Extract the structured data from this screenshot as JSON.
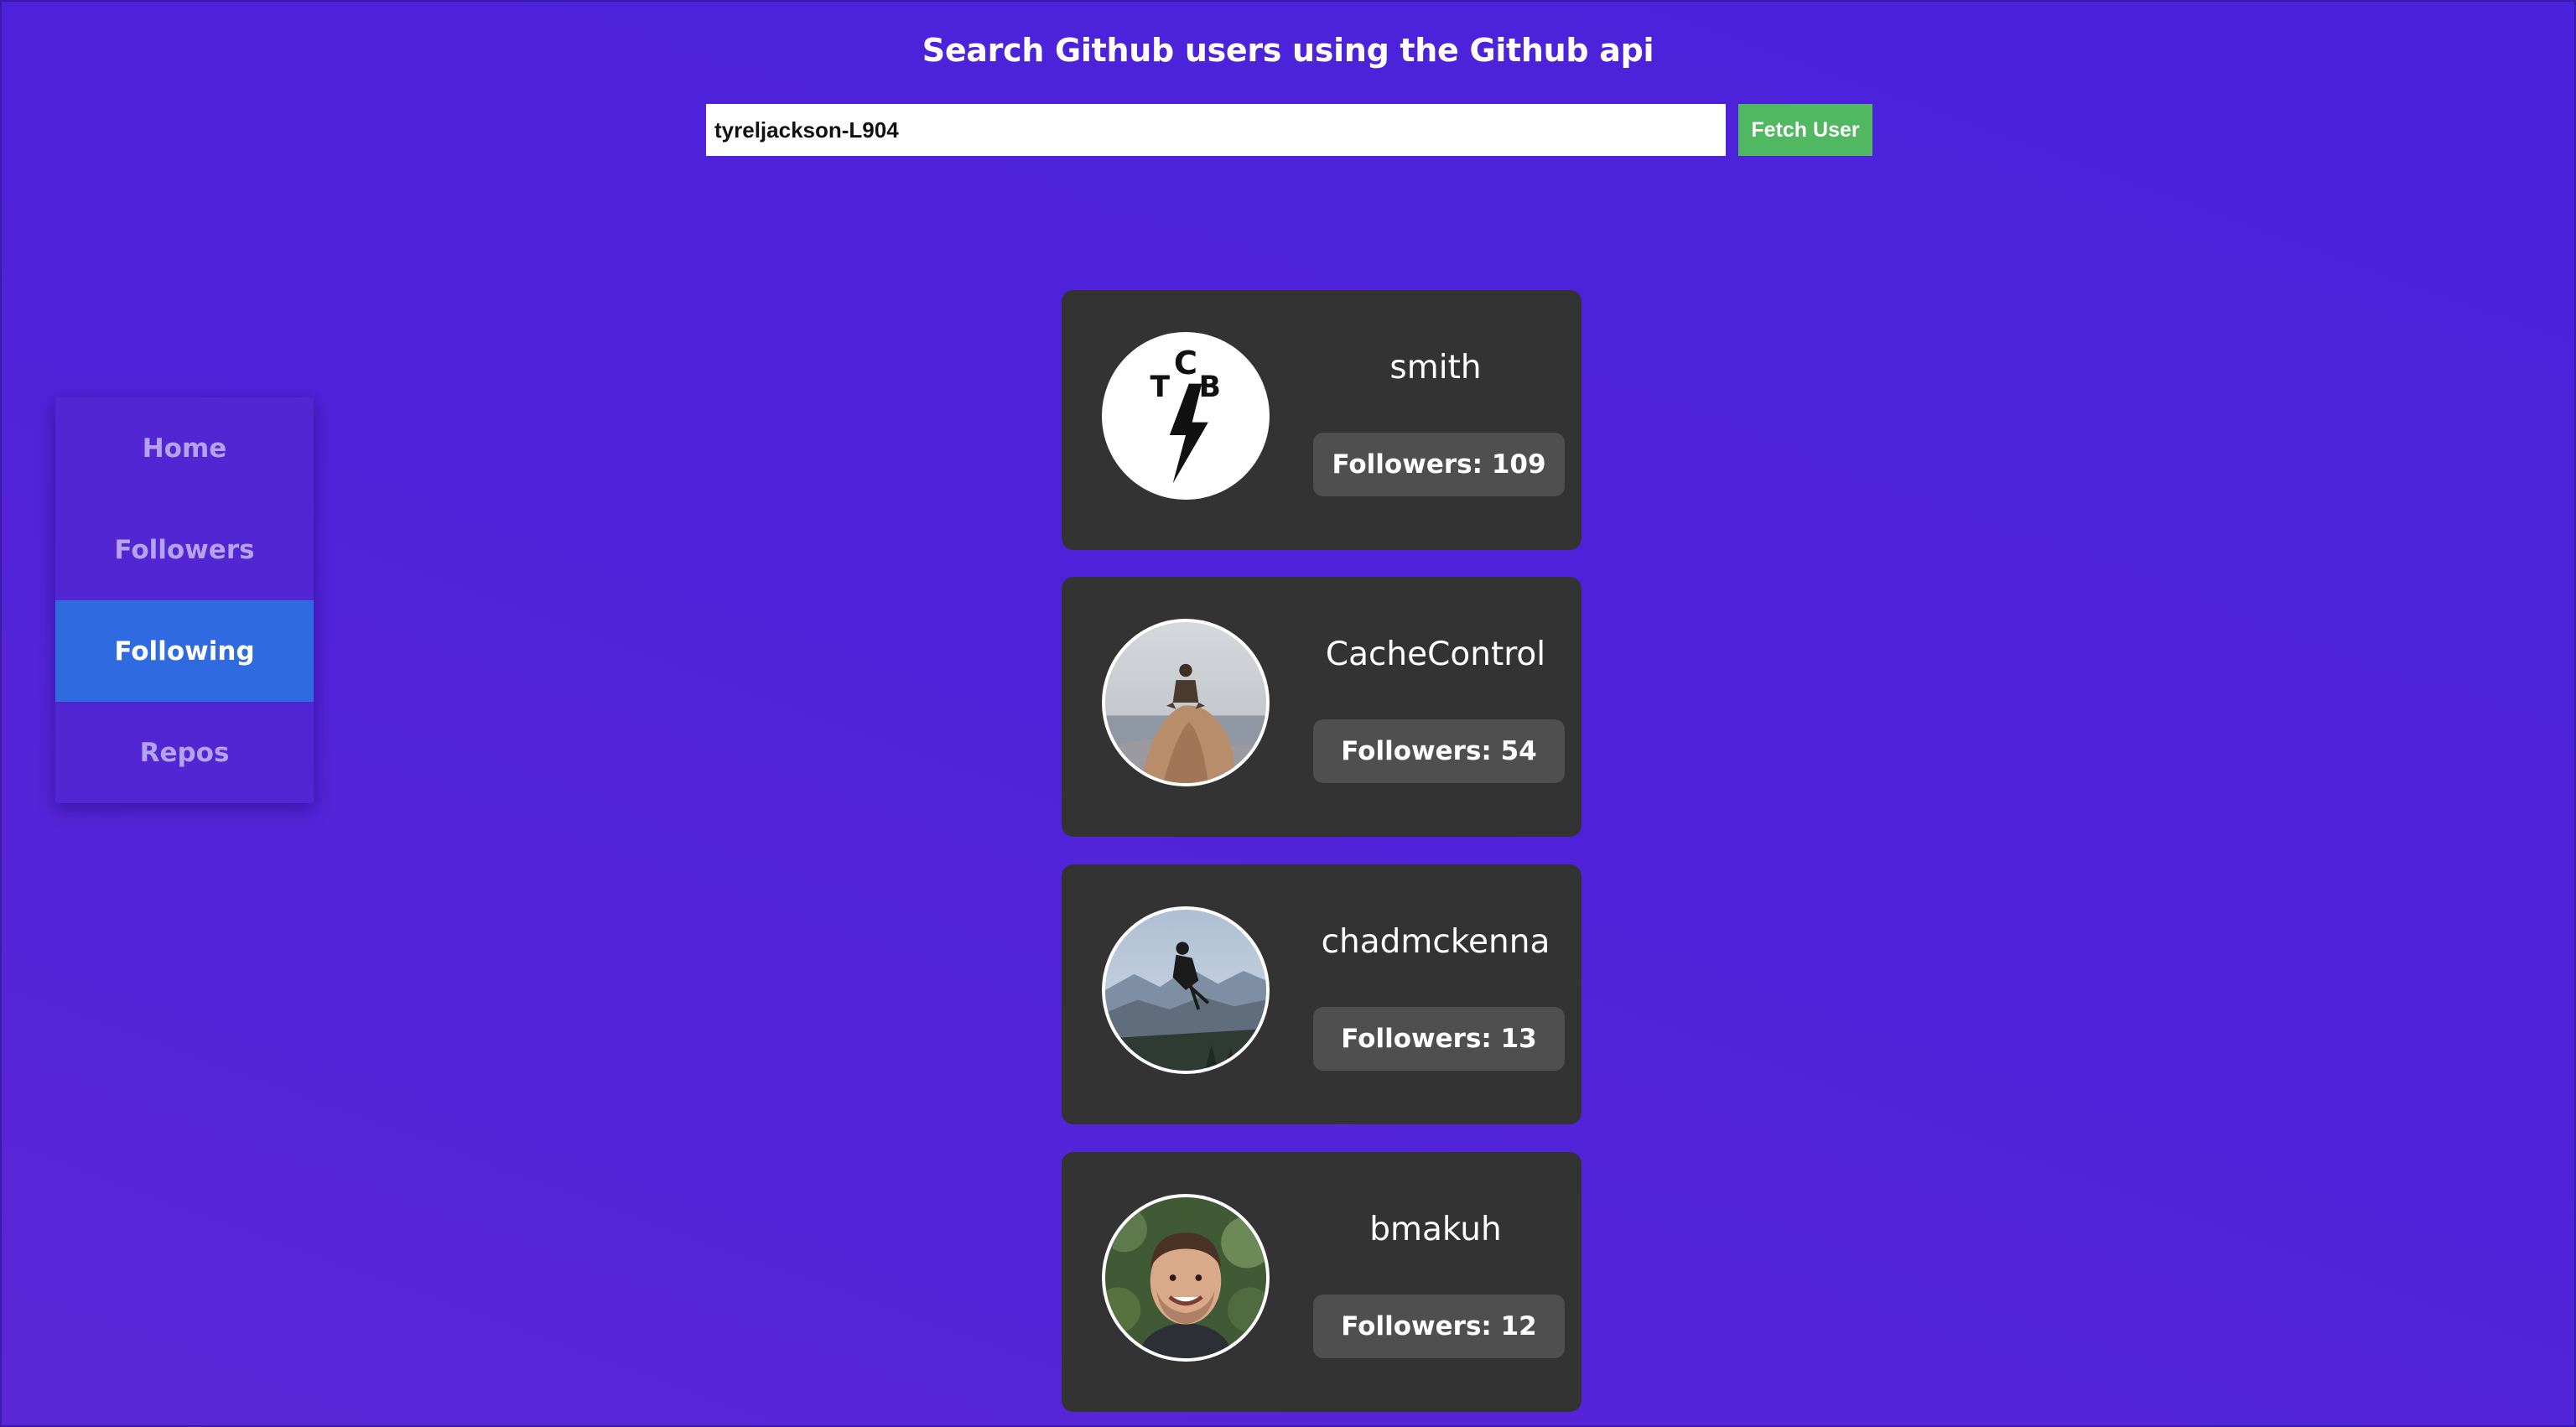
{
  "header": {
    "title": "Search Github users using the Github api"
  },
  "search": {
    "value": "tyreljackson-L904",
    "button_label": "Fetch User"
  },
  "sidebar": {
    "items": [
      {
        "label": "Home",
        "active": false
      },
      {
        "label": "Followers",
        "active": false
      },
      {
        "label": "Following",
        "active": true
      },
      {
        "label": "Repos",
        "active": false
      }
    ]
  },
  "users": [
    {
      "username": "smith",
      "followers": "Followers: 109",
      "avatar": "tcb-lightning-logo"
    },
    {
      "username": "CacheControl",
      "followers": "Followers: 54",
      "avatar": "person-on-rock-photo"
    },
    {
      "username": "chadmckenna",
      "followers": "Followers: 13",
      "avatar": "ski-jump-mountain-photo"
    },
    {
      "username": "bmakuh",
      "followers": "Followers: 12",
      "avatar": "smiling-man-photo"
    }
  ],
  "colors": {
    "background": "#4e22da",
    "active_nav": "#2f6ae0",
    "fetch_button": "#4fb860",
    "card": "#333333",
    "badge": "#4f4f4f"
  }
}
